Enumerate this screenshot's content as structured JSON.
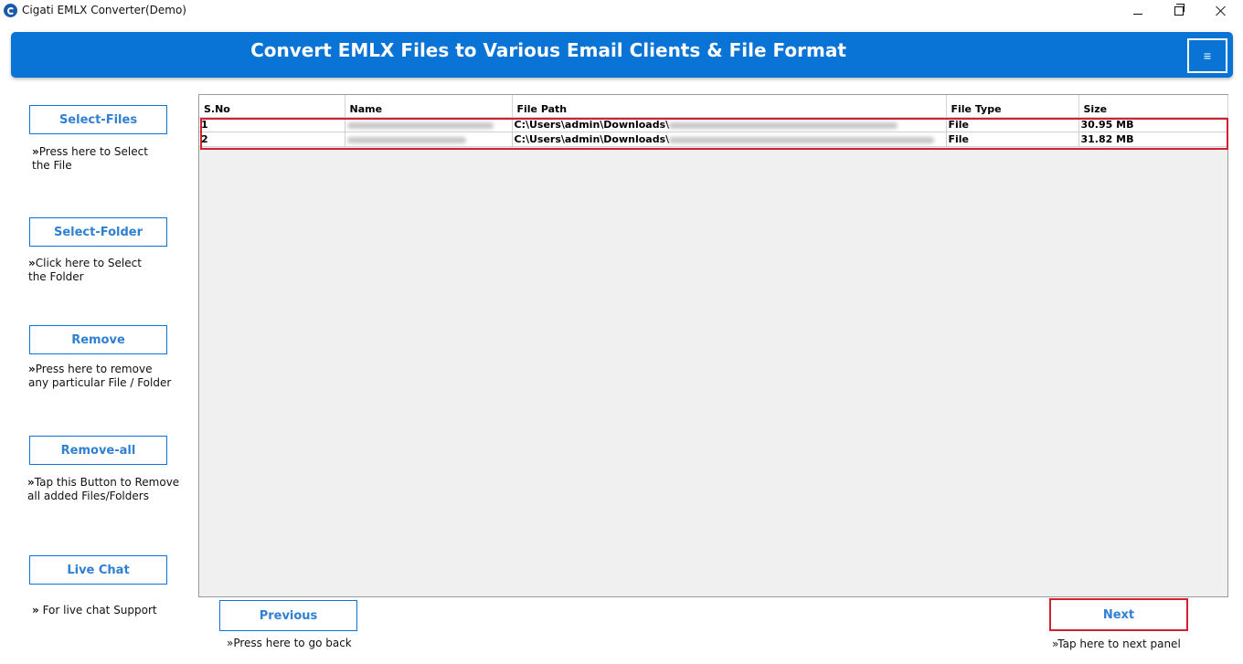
{
  "window": {
    "title": "Cigati EMLX Converter(Demo)"
  },
  "header": {
    "title": "Convert EMLX Files to Various Email Clients & File Format",
    "menu_icon": "≡"
  },
  "sidebar": {
    "select_files": {
      "label": "Select-Files",
      "hint_prefix": "»",
      "hint": "Press here to Select the File"
    },
    "select_folder": {
      "label": "Select-Folder",
      "hint_prefix": "»",
      "hint": "Click here to Select the Folder"
    },
    "remove": {
      "label": "Remove",
      "hint_prefix": "»",
      "hint": "Press here to remove any particular File / Folder"
    },
    "remove_all": {
      "label": "Remove-all",
      "hint_prefix": "»",
      "hint": "Tap this Button to Remove all added Files/Folders"
    },
    "live_chat": {
      "label": "Live Chat",
      "hint_prefix": "»",
      "hint": " For live chat Support"
    }
  },
  "table": {
    "columns": [
      "S.No",
      "Name",
      "File Path",
      "File Type",
      "Size"
    ],
    "rows": [
      {
        "sno": "1",
        "path_prefix": "C:\\Users\\admin\\Downloads\\",
        "type": "File",
        "size": "30.95 MB"
      },
      {
        "sno": "2",
        "path_prefix": "C:\\Users\\admin\\Downloads\\",
        "type": "File",
        "size": "31.82 MB"
      }
    ]
  },
  "footer": {
    "previous": {
      "label": "Previous",
      "hint": "»Press here to go back"
    },
    "next": {
      "label": "Next",
      "hint": "»Tap here to next panel"
    }
  },
  "colors": {
    "banner": "#0a74d6",
    "button_text": "#2f7fd3",
    "highlight": "#d32031"
  }
}
